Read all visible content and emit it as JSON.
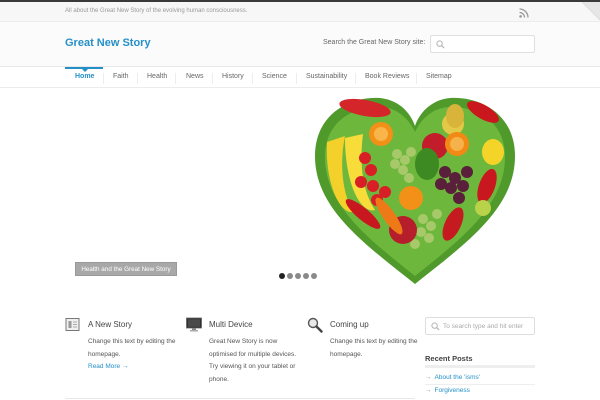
{
  "topbar": {
    "tagline": "All about the Great New Story of the evolving human consciousness.",
    "rss_icon": "rss-icon"
  },
  "header": {
    "site_title": "Great New Story",
    "search_label": "Search the Great New Story site:",
    "search_value": "",
    "search_icon": "magnifier-icon"
  },
  "nav": {
    "items": [
      {
        "label": "Home",
        "active": true
      },
      {
        "label": "Faith"
      },
      {
        "label": "Health"
      },
      {
        "label": "News"
      },
      {
        "label": "History"
      },
      {
        "label": "Science"
      },
      {
        "label": "Sustainability"
      },
      {
        "label": "Book Reviews"
      },
      {
        "label": "Sitemap"
      }
    ]
  },
  "slider": {
    "caption": "Health and the Great New Story",
    "image": "fruit-vegetable-heart",
    "slide_count": 5,
    "active_slide": 1
  },
  "feature_boxes": [
    {
      "title": "A New Story",
      "text": "Change this text by editing the homepage.",
      "link": "Read More →",
      "icon": "document-icon"
    },
    {
      "title": "Multi Device",
      "text": "Great New Story is now optimised for multiple devices. Try viewing it on your tablet or phone.",
      "icon": "monitor-icon"
    },
    {
      "title": "Coming up",
      "text": "Change this text by editing the homepage.",
      "icon": "magnifier-icon"
    }
  ],
  "sidebar": {
    "search_placeholder": "To search type and hit enter",
    "recent_posts_title": "Recent Posts",
    "recent_posts": [
      {
        "label": "About the 'isms'"
      },
      {
        "label": "Forgiveness"
      }
    ]
  },
  "colors": {
    "accent": "#2590c7",
    "topbar_border": "#3a3a3a",
    "caption_bg": "#a8a8a8"
  }
}
